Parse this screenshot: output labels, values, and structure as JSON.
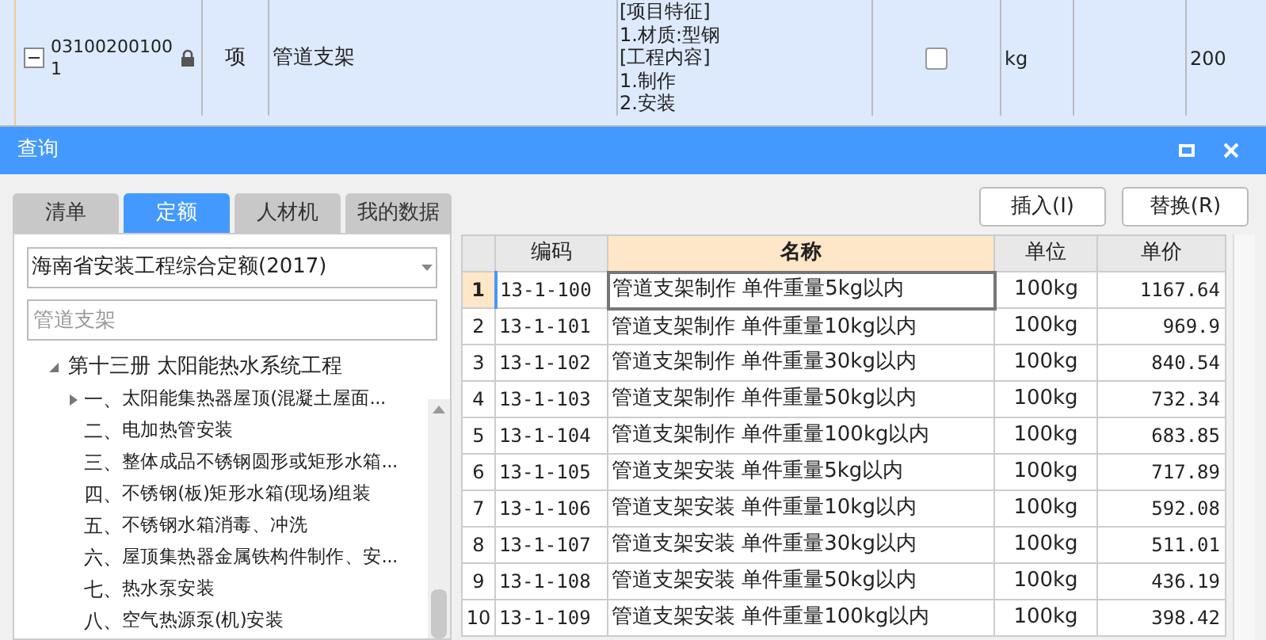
{
  "background_row": {
    "expanded": true,
    "code": "031002001001",
    "locked": true,
    "type": "项",
    "name": "管道支架",
    "features": [
      "[项目特征]",
      "1.材质:型钢",
      "[工程内容]",
      "1.制作",
      "2.安装"
    ],
    "checked": false,
    "unit": "kg",
    "quantity": "200"
  },
  "dialog": {
    "title": "查询",
    "tabs": [
      {
        "label": "清单",
        "selected": false
      },
      {
        "label": "定额",
        "selected": true
      },
      {
        "label": "人材机",
        "selected": false
      },
      {
        "label": "我的数据",
        "selected": false
      }
    ],
    "library": "海南省安装工程综合定额(2017)",
    "search": {
      "placeholder": "管道支架"
    },
    "tree": [
      {
        "label": "第十三册 太阳能热水系统工程",
        "expanded": true,
        "children": [
          {
            "number": "一、",
            "label": "太阳能集热器屋顶(混凝土屋面...",
            "collapsed": true
          },
          {
            "number": "二、",
            "label": "电加热管安装",
            "collapsed": false
          },
          {
            "number": "三、",
            "label": "整体成品不锈钢圆形或矩形水箱...",
            "collapsed": false
          },
          {
            "number": "四、",
            "label": "不锈钢(板)矩形水箱(现场)组装",
            "collapsed": false
          },
          {
            "number": "五、",
            "label": "不锈钢水箱消毒、冲洗",
            "collapsed": false
          },
          {
            "number": "六、",
            "label": "屋顶集热器金属铁构件制作、安...",
            "collapsed": false
          },
          {
            "number": "七、",
            "label": "热水泵安装",
            "collapsed": false
          },
          {
            "number": "八、",
            "label": "空气热源泵(机)安装",
            "collapsed": false
          }
        ]
      }
    ],
    "buttons": [
      "插入(I)",
      "替换(R)"
    ],
    "table": {
      "columns": [
        "编码",
        "名称",
        "单位",
        "单价"
      ],
      "rows": [
        {
          "index": "1",
          "code": "13-1-100",
          "name": "管道支架制作 单件重量5kg以内",
          "unit": "100kg",
          "price": "1167.64",
          "selected": true
        },
        {
          "index": "2",
          "code": "13-1-101",
          "name": "管道支架制作 单件重量10kg以内",
          "unit": "100kg",
          "price": "969.9",
          "selected": false
        },
        {
          "index": "3",
          "code": "13-1-102",
          "name": "管道支架制作 单件重量30kg以内",
          "unit": "100kg",
          "price": "840.54",
          "selected": false
        },
        {
          "index": "4",
          "code": "13-1-103",
          "name": "管道支架制作 单件重量50kg以内",
          "unit": "100kg",
          "price": "732.34",
          "selected": false
        },
        {
          "index": "5",
          "code": "13-1-104",
          "name": "管道支架制作 单件重量100kg以内",
          "unit": "100kg",
          "price": "683.85",
          "selected": false
        },
        {
          "index": "6",
          "code": "13-1-105",
          "name": "管道支架安装 单件重量5kg以内",
          "unit": "100kg",
          "price": "717.89",
          "selected": false
        },
        {
          "index": "7",
          "code": "13-1-106",
          "name": "管道支架安装 单件重量10kg以内",
          "unit": "100kg",
          "price": "592.08",
          "selected": false
        },
        {
          "index": "8",
          "code": "13-1-107",
          "name": "管道支架安装 单件重量30kg以内",
          "unit": "100kg",
          "price": "511.01",
          "selected": false
        },
        {
          "index": "9",
          "code": "13-1-108",
          "name": "管道支架安装 单件重量50kg以内",
          "unit": "100kg",
          "price": "436.19",
          "selected": false
        },
        {
          "index": "10",
          "code": "13-1-109",
          "name": "管道支架安装 单件重量100kg以内",
          "unit": "100kg",
          "price": "398.42",
          "selected": false
        }
      ]
    }
  }
}
